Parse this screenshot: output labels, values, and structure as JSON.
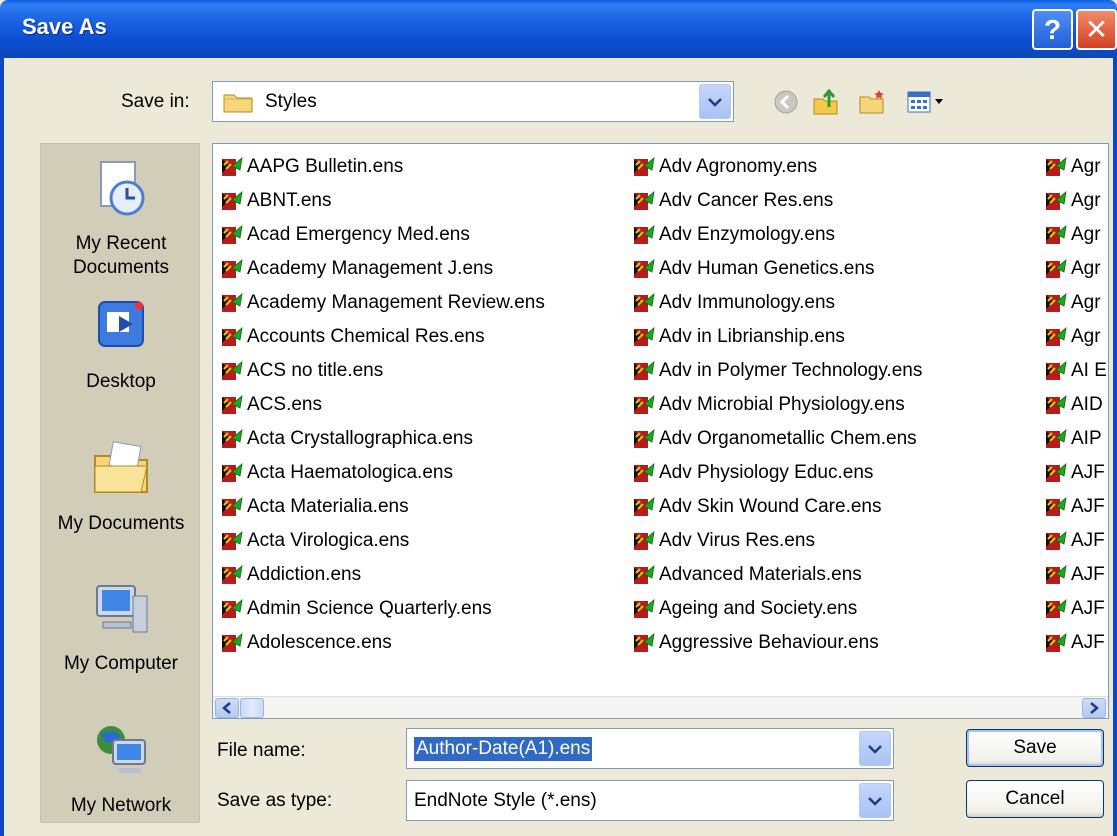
{
  "window": {
    "title": "Save As"
  },
  "save_in": {
    "label": "Save in:",
    "value": "Styles"
  },
  "places": [
    {
      "label_lines": [
        "My Recent",
        "Documents"
      ]
    },
    {
      "label_lines": [
        "Desktop"
      ]
    },
    {
      "label_lines": [
        "My Documents"
      ]
    },
    {
      "label_lines": [
        "My Computer"
      ]
    },
    {
      "label_lines": [
        "My Network"
      ]
    }
  ],
  "files": {
    "column1": [
      "AAPG Bulletin.ens",
      "ABNT.ens",
      "Acad Emergency Med.ens",
      "Academy Management J.ens",
      "Academy Management Review.ens",
      "Accounts Chemical Res.ens",
      "ACS no title.ens",
      "ACS.ens",
      "Acta Crystallographica.ens",
      "Acta Haematologica.ens",
      "Acta Materialia.ens",
      "Acta Virologica.ens",
      "Addiction.ens",
      "Admin Science Quarterly.ens",
      "Adolescence.ens"
    ],
    "column2": [
      "Adv Agronomy.ens",
      "Adv Cancer Res.ens",
      "Adv Enzymology.ens",
      "Adv Human Genetics.ens",
      "Adv Immunology.ens",
      "Adv in Librianship.ens",
      "Adv in Polymer Technology.ens",
      "Adv Microbial Physiology.ens",
      "Adv Organometallic Chem.ens",
      "Adv Physiology Educ.ens",
      "Adv Skin Wound Care.ens",
      "Adv Virus Res.ens",
      "Advanced Materials.ens",
      "Ageing and Society.ens",
      "Aggressive Behaviour.ens"
    ],
    "column3": [
      "Agr",
      "Agr",
      "Agr",
      "Agr",
      "Agr",
      "Agr",
      "AI E",
      "AID",
      "AIP",
      "AJF",
      "AJF",
      "AJF",
      "AJF",
      "AJF",
      "AJF"
    ]
  },
  "file_name": {
    "label": "File name:",
    "value": "Author-Date(A1).ens"
  },
  "save_as_type": {
    "label": "Save as type:",
    "value": "EndNote Style (*.ens)"
  },
  "buttons": {
    "save": "Save",
    "cancel": "Cancel"
  },
  "colors": {
    "titlebar": "#0a4ed0",
    "selection": "#316ac5",
    "dialog_bg": "#ece9d8"
  }
}
